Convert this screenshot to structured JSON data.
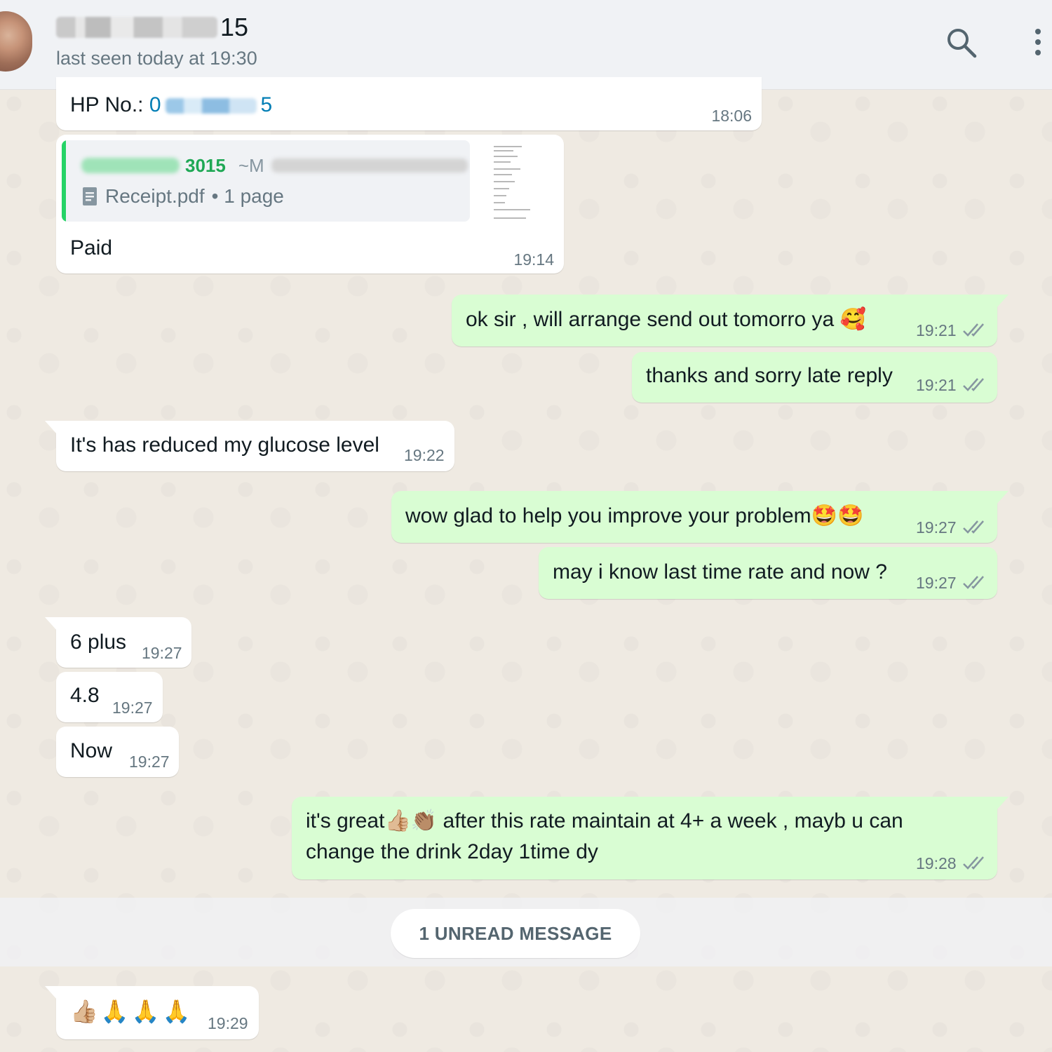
{
  "header": {
    "contact_name_suffix": "15",
    "status": "last seen today at 19:30"
  },
  "messages": {
    "m1": {
      "label": "HP No.:",
      "number_start": "0",
      "number_end": "5",
      "time": "18:06"
    },
    "m2": {
      "doc_sender_suffix": "3015",
      "doc_sender_name_start": "~M",
      "doc_name": "Receipt.pdf",
      "doc_pages": "• 1 page",
      "caption": "Paid",
      "time": "19:14"
    },
    "m3": {
      "text": "ok sir ,  will arrange send out tomorro ya",
      "emoji": "🥰",
      "time": "19:21"
    },
    "m4": {
      "text": "thanks and sorry late reply",
      "time": "19:21"
    },
    "m5": {
      "text": "It's has reduced my glucose level",
      "time": "19:22"
    },
    "m6": {
      "text": "wow glad to help you improve your problem",
      "emoji": "🤩🤩",
      "time": "19:27"
    },
    "m7": {
      "text": "may i know last time rate and now ?",
      "time": "19:27"
    },
    "m8": {
      "text": "6 plus",
      "time": "19:27"
    },
    "m9": {
      "text": "4.8",
      "time": "19:27"
    },
    "m10": {
      "text": "Now",
      "time": "19:27"
    },
    "m11": {
      "text_a": "it's great",
      "emoji": "👍🏼👏🏽",
      "text_b": " after this rate maintain at 4+ a week , mayb u can",
      "text_c": "change the drink 2day 1time dy",
      "time": "19:28"
    },
    "m12": {
      "emoji": "👍🏼🙏🙏🙏",
      "time": "19:29"
    }
  },
  "unread_divider": "1 UNREAD MESSAGE",
  "colors": {
    "incoming_bubble": "#ffffff",
    "outgoing_bubble": "#d9fdd3",
    "chat_background": "#efeae2",
    "header_background": "#f0f2f5",
    "read_ticks": "#8696a0",
    "doc_accent": "#25d366"
  },
  "icons": {
    "search": "search-icon",
    "menu": "more-options-icon",
    "ticks": "double-check-icon",
    "document": "document-icon"
  }
}
